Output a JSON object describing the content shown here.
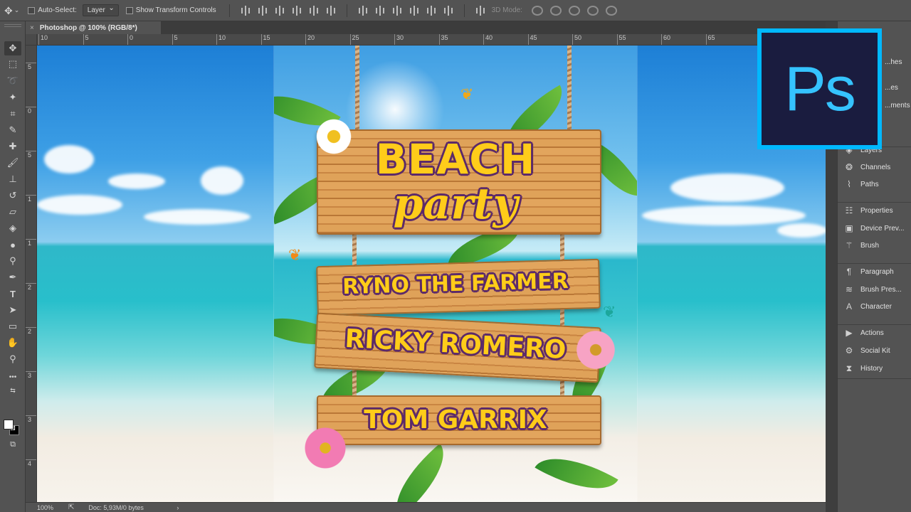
{
  "options_bar": {
    "auto_select_label": "Auto-Select:",
    "auto_select_value": "Layer",
    "transform_label": "Show Transform Controls",
    "mode_3d_label": "3D Mode:"
  },
  "document_tab": {
    "title": "Photoshop @ 100% (RGB/8*)",
    "close_glyph": "×"
  },
  "rulers": {
    "horizontal": [
      "10",
      "5",
      "0",
      "5",
      "10",
      "15",
      "20",
      "25",
      "30",
      "35",
      "40",
      "45",
      "50",
      "55",
      "60",
      "65"
    ],
    "vertical": [
      "5",
      "0",
      "5",
      "1",
      "1",
      "2",
      "2",
      "3",
      "3",
      "4"
    ]
  },
  "poster": {
    "headline": "BEACH",
    "subhead": "party",
    "artists": [
      "RYNO THE FARMER",
      "RICKY ROMERO",
      "TOM GARRIX"
    ]
  },
  "panel": {
    "items": [
      {
        "label": "...hes",
        "icon": "swatches-icon"
      },
      {
        "label": "...es",
        "icon": "styles-icon"
      },
      {
        "label": "...ments",
        "icon": "adjustments-icon"
      },
      {
        "label": "Layers",
        "icon": "layers-icon"
      },
      {
        "label": "Channels",
        "icon": "channels-icon"
      },
      {
        "label": "Paths",
        "icon": "paths-icon"
      },
      {
        "label": "Properties",
        "icon": "properties-icon"
      },
      {
        "label": "Device Prev...",
        "icon": "device-preview-icon"
      },
      {
        "label": "Brush",
        "icon": "brush-icon"
      },
      {
        "label": "Paragraph",
        "icon": "paragraph-icon"
      },
      {
        "label": "Brush Pres...",
        "icon": "brush-presets-icon"
      },
      {
        "label": "Character",
        "icon": "character-icon"
      },
      {
        "label": "Actions",
        "icon": "actions-icon"
      },
      {
        "label": "Social Kit",
        "icon": "social-kit-icon"
      },
      {
        "label": "History",
        "icon": "history-icon"
      }
    ]
  },
  "logo": {
    "text": "Ps"
  },
  "status_bar": {
    "zoom": "100%",
    "doc_info": "Doc: 5,93M/0 bytes",
    "arrow": "›"
  },
  "colors": {
    "ui_bg": "#535353",
    "logo_border": "#00b8ff",
    "logo_bg": "#1a1c3f",
    "title_text": "#ffcc1a",
    "title_outline": "#5c2a6a"
  }
}
